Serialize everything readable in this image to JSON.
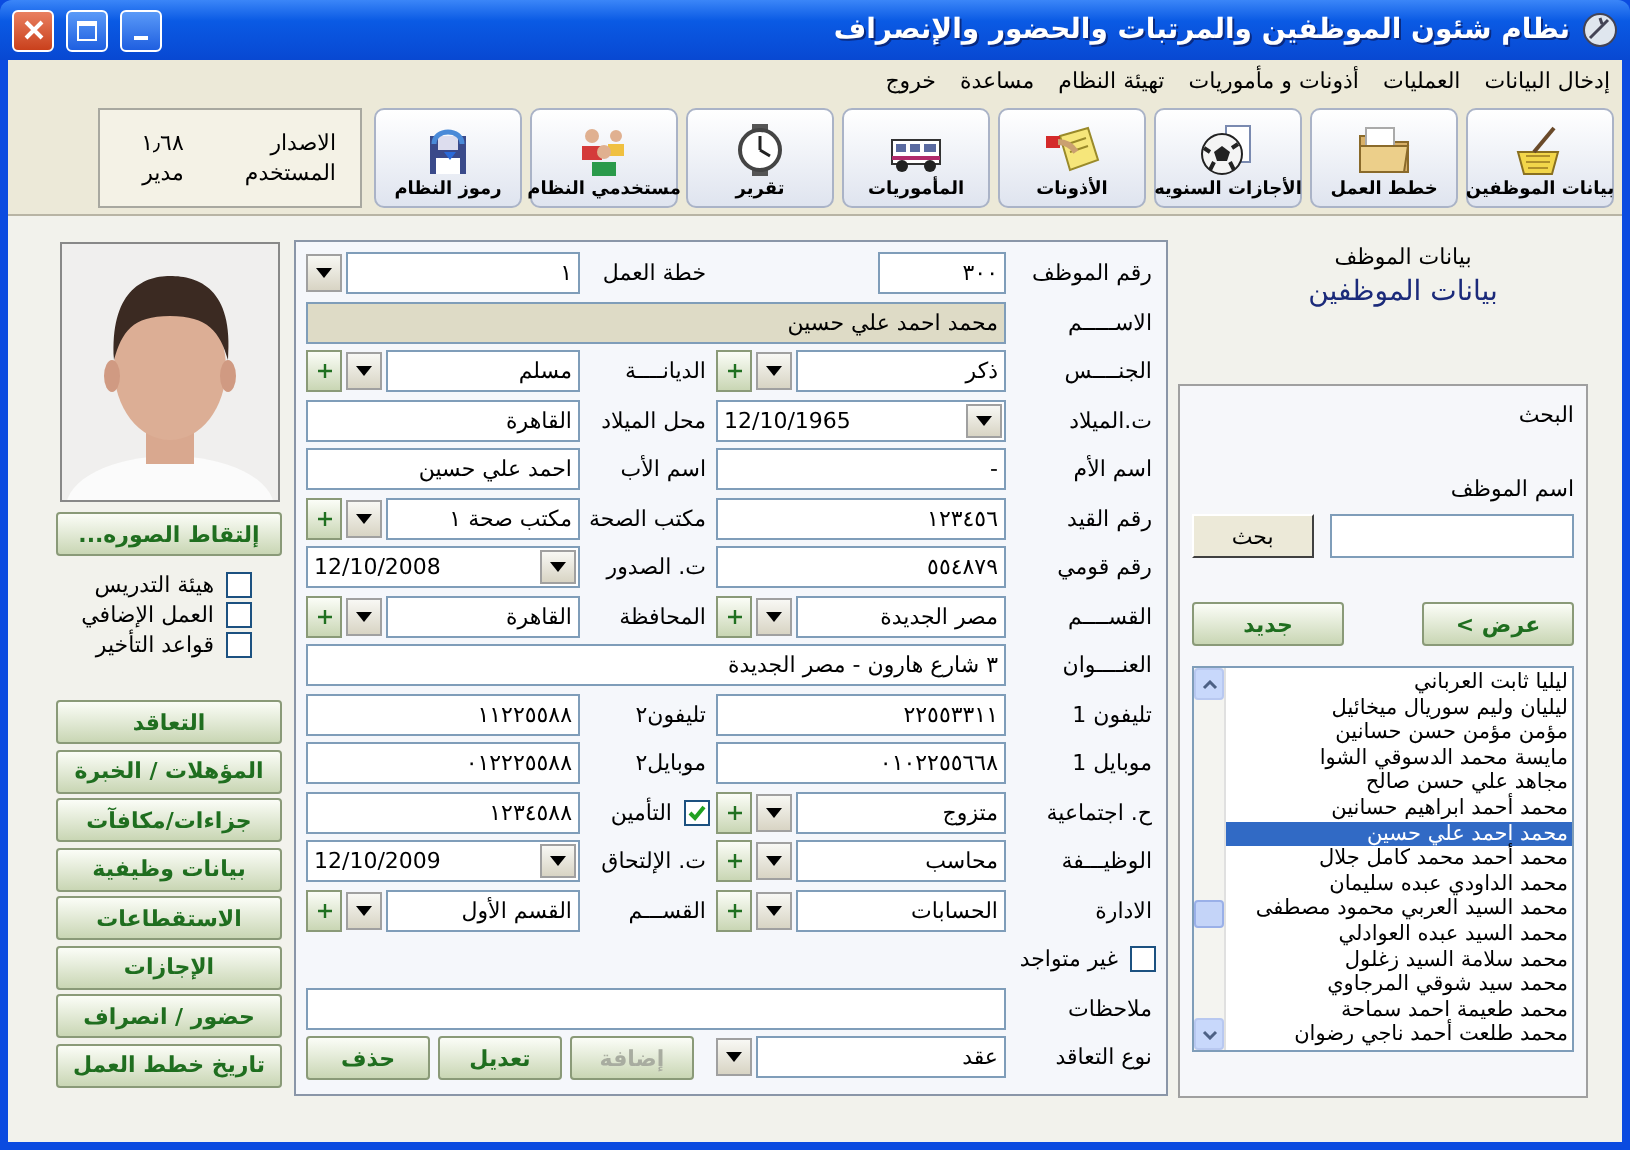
{
  "window": {
    "title": "نظام شئون الموظفين والمرتبات والحضور والإنصراف"
  },
  "menu": [
    "إدخال البيانات",
    "العمليات",
    "أذونات و مأموريات",
    "تهيئة النظام",
    "مساعدة",
    "خروج"
  ],
  "toolbar": [
    {
      "label": "بيانات الموظفين"
    },
    {
      "label": "خطط العمل"
    },
    {
      "label": "الأجازات السنويه"
    },
    {
      "label": "الأذونات"
    },
    {
      "label": "المأموريات"
    },
    {
      "label": "تقرير"
    },
    {
      "label": "مستخدمي النظام"
    },
    {
      "label": "رموز النظام"
    }
  ],
  "info": [
    {
      "label": "الاصدار",
      "value": "١٫٦٨"
    },
    {
      "label": "المستخدم",
      "value": "مدير"
    }
  ],
  "sidebar": {
    "capture_button": "إلتقاط الصوره...",
    "checkboxes": [
      {
        "label": "هيئة التدريس",
        "checked": false
      },
      {
        "label": "العمل الإضافي",
        "checked": false
      },
      {
        "label": "قواعد التأخير",
        "checked": false
      }
    ],
    "buttons": [
      "التعاقد",
      "المؤهلات / الخبرة",
      "جزاءات/مكافآت",
      "بيانات وظيفية",
      "الاستقطاعات",
      "الإجازات",
      "حضور / انصراف",
      "تاريخ خطط العمل"
    ]
  },
  "form": {
    "rows": [
      [
        {
          "label": "رقم الموظف",
          "kind": "short",
          "value": "٣٠٠"
        },
        {
          "label": "خطة العمل",
          "kind": "combo",
          "value": "١",
          "add_button": false
        }
      ],
      [
        {
          "label": "الاســـــم",
          "kind": "readonly",
          "value": "محمد احمد علي حسين"
        }
      ],
      [
        {
          "label": "الجنــــس",
          "kind": "combo",
          "value": "ذكر",
          "add_button": true
        },
        {
          "label": "الديانــــة",
          "kind": "combo",
          "value": "مسلم",
          "add_button": true
        }
      ],
      [
        {
          "label": "ت.الميلاد",
          "kind": "date",
          "value": "12/10/1965"
        },
        {
          "label": "محل الميلاد",
          "kind": "text",
          "value": "القاهرة"
        }
      ],
      [
        {
          "label": "اسم الأم",
          "kind": "text",
          "value": "-"
        },
        {
          "label": "اسم الأب",
          "kind": "text",
          "value": "احمد علي حسين"
        }
      ],
      [
        {
          "label": "رقم القيد",
          "kind": "text",
          "value": "١٢٣٤٥٦"
        },
        {
          "label": "مكتب الصحة",
          "kind": "combo",
          "value": "مكتب صحة ١",
          "add_button": true
        }
      ],
      [
        {
          "label": "رقم قومي",
          "kind": "text",
          "value": "٥٥٤٨٧٩"
        },
        {
          "label": "ت. الصدور",
          "kind": "date",
          "value": "12/10/2008"
        }
      ],
      [
        {
          "label": "القســــم",
          "kind": "combo",
          "value": "مصر الجديدة",
          "add_button": true
        },
        {
          "label": "المحافظة",
          "kind": "combo",
          "value": "القاهرة",
          "add_button": true
        }
      ],
      [
        {
          "label": "العنــــوان",
          "kind": "wide",
          "value": "٣ شارع هارون - مصر الجديدة"
        }
      ],
      [
        {
          "label": "تليفون 1",
          "kind": "text",
          "value": "٢٢٥٥٣٣١١"
        },
        {
          "label": "تليفون٢",
          "kind": "text",
          "value": "١١٢٢٥٥٨٨"
        }
      ],
      [
        {
          "label": "موبايل 1",
          "kind": "text",
          "value": "٠١٠٢٢٥٥٦٦٨"
        },
        {
          "label": "موبايل٢",
          "kind": "text",
          "value": "٠١٢٢٢٥٥٨٨"
        }
      ],
      [
        {
          "label": "ح. اجتماعية",
          "kind": "combo",
          "value": "متزوج",
          "add_button": true
        },
        {
          "label": "التأمين",
          "kind": "check_text",
          "checked": true,
          "value": "١٢٣٤٥٨٨"
        }
      ],
      [
        {
          "label": "الوظيـــفة",
          "kind": "combo",
          "value": "محاسب",
          "add_button": true
        },
        {
          "label": "ت. الإلتحاق",
          "kind": "date",
          "value": "12/10/2009"
        }
      ],
      [
        {
          "label": "الادارة",
          "kind": "combo",
          "value": "الحسابات",
          "add_button": true
        },
        {
          "label": "القســـم",
          "kind": "combo",
          "value": "القسم الأول",
          "add_button": true
        }
      ],
      [
        {
          "label": "غير متواجد",
          "kind": "checkbox",
          "checked": false
        }
      ],
      [
        {
          "label": "ملاحظات",
          "kind": "wide"
        }
      ],
      [
        {
          "label": "نوع التعاقد",
          "kind": "combo",
          "value": "عقد",
          "add_button": false
        }
      ]
    ],
    "actions": [
      {
        "label": "إضافة",
        "disabled": true
      },
      {
        "label": "تعديل",
        "disabled": false
      },
      {
        "label": "حذف",
        "disabled": false
      }
    ]
  },
  "search_panel": {
    "subtitle": "بيانات الموظف",
    "title": "بيانات الموظفين",
    "heading": "البحث",
    "field_label": "اسم الموظف",
    "search_button": "بحث",
    "buttons": [
      "عرض >",
      "جديد"
    ],
    "results": [
      {
        "name": "ليليا ثابت العرباني",
        "selected": false
      },
      {
        "name": "ليليان وليم سوريال ميخائيل",
        "selected": false
      },
      {
        "name": "مؤمن مؤمن حسن حسانين",
        "selected": false
      },
      {
        "name": "مايسة محمد الدسوقي الشوا",
        "selected": false
      },
      {
        "name": "مجاهد علي حسن صالح",
        "selected": false
      },
      {
        "name": "محمد أحمد ابراهيم حسانين",
        "selected": false
      },
      {
        "name": "محمد احمد علي حسين",
        "selected": true
      },
      {
        "name": "محمد أحمد محمد كامل جلال",
        "selected": false
      },
      {
        "name": "محمد الداودي عبده سليمان",
        "selected": false
      },
      {
        "name": "محمد السيد العربي محمود مصطفى",
        "selected": false
      },
      {
        "name": "محمد السيد عبده العوادلي",
        "selected": false
      },
      {
        "name": "محمد سلامة السيد زغلول",
        "selected": false
      },
      {
        "name": "محمد سيد شوقي المرجاوي",
        "selected": false
      },
      {
        "name": "محمد طعيمة احمد سماحة",
        "selected": false
      },
      {
        "name": "محمد طلعت أحمد ناجي رضوان",
        "selected": false
      }
    ]
  }
}
